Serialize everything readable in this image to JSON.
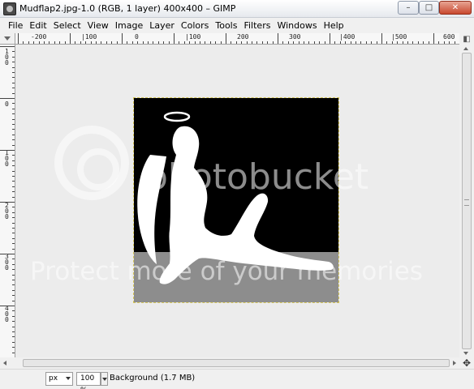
{
  "window": {
    "title": "Mudflap2.jpg-1.0 (RGB, 1 layer) 400x400 – GIMP",
    "minimize_label": "–",
    "maximize_label": "□",
    "close_label": "✕",
    "app_icon": "gimp-icon"
  },
  "menu": {
    "items": [
      "File",
      "Edit",
      "Select",
      "View",
      "Image",
      "Layer",
      "Colors",
      "Tools",
      "Filters",
      "Windows",
      "Help"
    ]
  },
  "rulers": {
    "horizontal_labels": [
      "-200",
      "|100",
      "0",
      "|100",
      "200",
      "300",
      "|400",
      "|500",
      "600"
    ],
    "vertical_labels": [
      "100",
      "0",
      "100",
      "200",
      "300",
      "400"
    ]
  },
  "canvas": {
    "image_icon": "mudflap-angel-silhouette",
    "watermark_text": "Protect more of your memories",
    "watermark_brand": "photobucket",
    "background_color": "#ececec",
    "image_background": "#000000",
    "image_floor": "#8d8d8d"
  },
  "statusbar": {
    "unit": "px",
    "zoom": "100 %",
    "status": "Background (1.7 MB)"
  },
  "navigation": {
    "corner_icon": "navigate-cross-icon",
    "toggle_icon": "quick-mask-icon"
  }
}
